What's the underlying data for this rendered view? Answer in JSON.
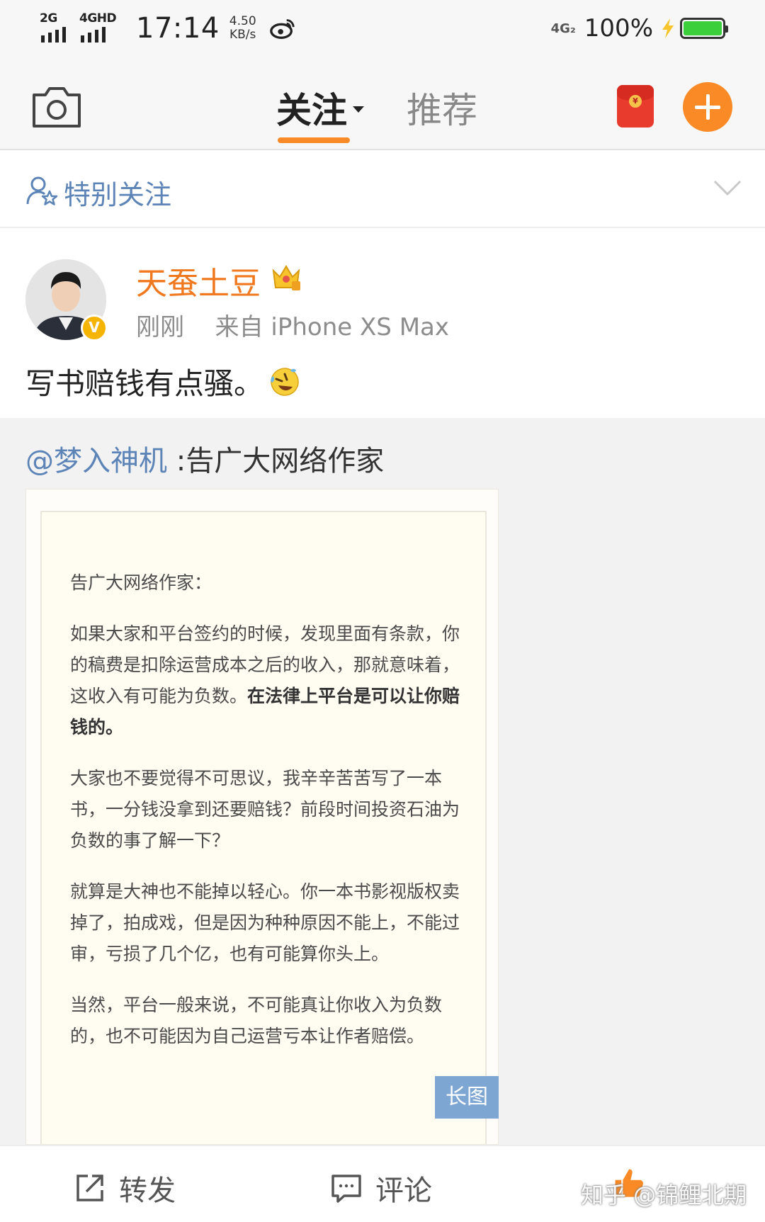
{
  "status_bar": {
    "signal1_label": "2G",
    "signal2_label": "4GHD",
    "time": "17:14",
    "speed_value": "4.50",
    "speed_unit": "KB/s",
    "network_label": "4G₂",
    "battery_percent": "100%",
    "battery_level": 1.0,
    "icons": [
      "weibo-icon",
      "bolt-icon",
      "battery-icon"
    ]
  },
  "top_nav": {
    "tab_follow": "关注",
    "tab_recommend": "推荐",
    "active_tab": "关注",
    "accent_color": "#f98a26",
    "redpacket_symbol": "¥",
    "icons": [
      "camera-icon",
      "red-packet-icon",
      "add-icon"
    ]
  },
  "special_follow": {
    "label": "特别关注",
    "color": "#5c84b7",
    "icons": [
      "user-star-icon",
      "chevron-down-icon"
    ]
  },
  "post": {
    "author": "天蚕土豆",
    "verified_badge": "V",
    "time": "刚刚",
    "source": "来自 iPhone XS Max",
    "text": "写书赔钱有点骚。",
    "name_color": "#f0781e",
    "icons": [
      "crown-icon",
      "laugh-cry-emoji-icon"
    ]
  },
  "repost": {
    "mention": "@梦入神机",
    "text": ":告广大网络作家",
    "mention_color": "#5c84b7",
    "image": {
      "tag": "长图",
      "title": "告广大网络作家：",
      "p1_plain": "如果大家和平台签约的时候，发现里面有条款，你的稿费是扣除运营成本之后的收入，那就意味着，这收入有可能为负数。",
      "p1_bold": "在法律上平台是可以让你赔钱的。",
      "p2": "大家也不要觉得不可思议，我辛辛苦苦写了一本书，一分钱没拿到还要赔钱？前段时间投资石油为负数的事了解一下？",
      "p3": "就算是大神也不能掉以轻心。你一本书影视版权卖掉了，拍成戏，但是因为种种原因不能上，不能过审，亏损了几个亿，也有可能算你头上。",
      "p4": "当然，平台一般来说，不可能真让你收入为负数的，也不可能因为自己运营亏本让作者赔偿。"
    }
  },
  "action_bar": {
    "repost_label": "转发",
    "comment_label": "评论",
    "watermark": "知乎 @锦鲤北期",
    "icons": [
      "share-icon",
      "comment-icon",
      "thumbs-up-icon"
    ]
  }
}
